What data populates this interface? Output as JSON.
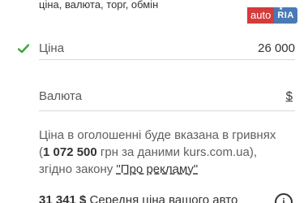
{
  "subheader": "ціна, валюта, торг, обмін",
  "logo": {
    "auto": "auto",
    "ria": "RIA"
  },
  "price": {
    "label": "Ціна",
    "value": "26 000"
  },
  "currency": {
    "label": "Валюта",
    "value": "$"
  },
  "note": {
    "line1": "Ціна в оголошенні буде вказана в гривнях",
    "uah_open": "(",
    "uah_amount": "1 072 500",
    "uah_rest": " грн за даними kurs.com.ua),",
    "law_prefix": "згідно закону ",
    "law_link": "\"Про рекламу\""
  },
  "average": {
    "amount": "31 341 $",
    "text": " Середня ціна вашого авто"
  },
  "icons": {
    "check": "check-icon",
    "info": "info-icon"
  },
  "colors": {
    "check": "#3aa53a",
    "logo_auto": "#d43c3c",
    "logo_ria": "#4a7ab5"
  }
}
